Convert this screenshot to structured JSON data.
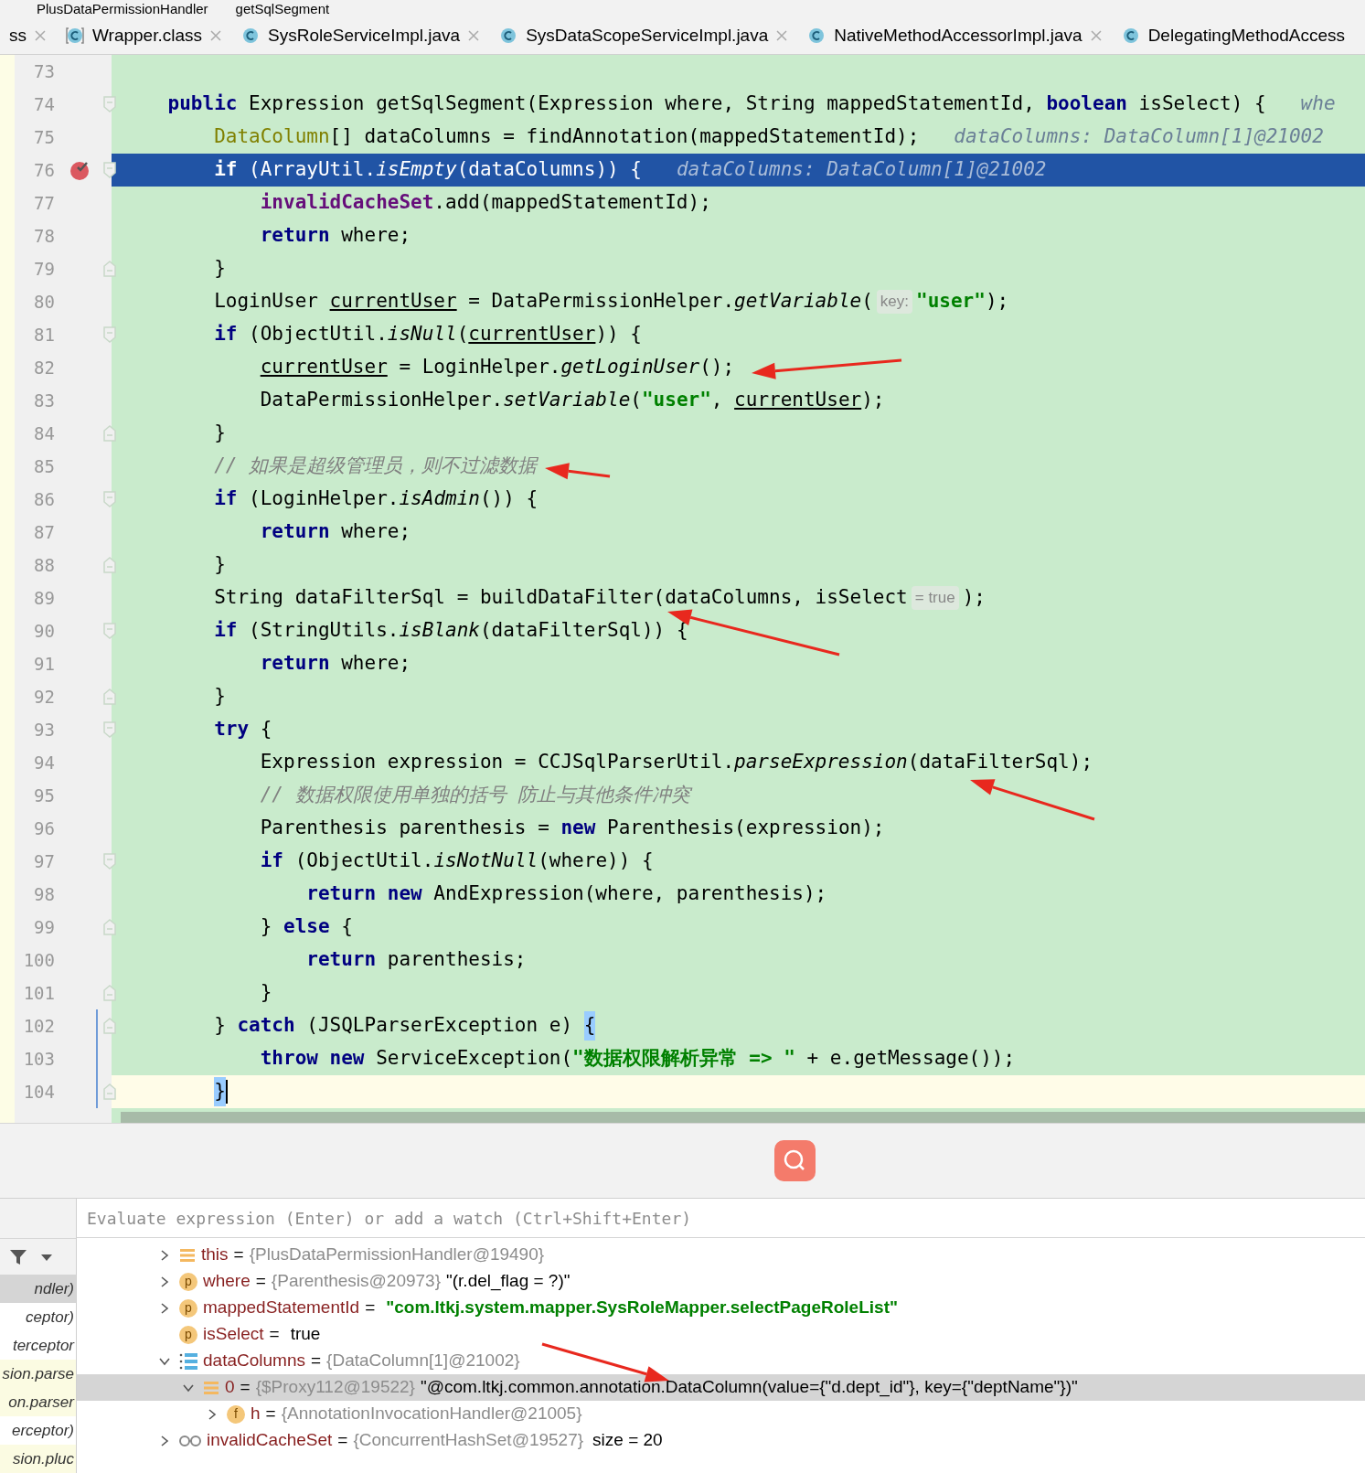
{
  "breadcrumb": [
    "PlusDataPermissionHandler",
    "getSqlSegment"
  ],
  "tabs": [
    {
      "label": "ss",
      "kind": "none",
      "closable": true
    },
    {
      "label": "Wrapper.class",
      "kind": "class",
      "closable": true
    },
    {
      "label": "SysRoleServiceImpl.java",
      "kind": "java",
      "closable": true
    },
    {
      "label": "SysDataScopeServiceImpl.java",
      "kind": "java",
      "closable": true
    },
    {
      "label": "NativeMethodAccessorImpl.java",
      "kind": "java",
      "closable": true
    },
    {
      "label": "DelegatingMethodAccess",
      "kind": "java",
      "closable": false
    }
  ],
  "lines": [
    {
      "number": "73"
    },
    {
      "number": "74",
      "kind": "block_start",
      "tokens": [
        {
          "kind": "keyword",
          "text": "public"
        },
        {
          "kind": "plain",
          "text": " Expression getSqlSegment(Expression where, String mappedStatementId, "
        },
        {
          "kind": "keyword",
          "text": "boolean"
        },
        {
          "kind": "plain",
          "text": " isSelect) {"
        },
        {
          "kind": "debug",
          "text": "   whe"
        }
      ],
      "children": [
        {
          "number": "75",
          "tokens": [
            {
              "kind": "type",
              "text": "DataColumn"
            },
            {
              "kind": "plain",
              "text": "[] dataColumns = findAnnotation(mappedStatementId);"
            },
            {
              "kind": "debug",
              "text": "   dataColumns: DataColumn[1]@21002"
            }
          ]
        },
        {
          "number": "76",
          "kind": "block_start",
          "breakpoint": true,
          "selected": true,
          "tokens": [
            {
              "kind": "keyword",
              "text": "if"
            },
            {
              "kind": "plain",
              "text": " (ArrayUtil."
            },
            {
              "kind": "static",
              "text": "isEmpty"
            },
            {
              "kind": "plain",
              "text": "(dataColumns)) {"
            },
            {
              "kind": "debug",
              "text": "   dataColumns: DataColumn[1]@21002"
            }
          ],
          "children": [
            {
              "number": "77",
              "tokens": [
                {
                  "kind": "field",
                  "text": "invalidCacheSet"
                },
                {
                  "kind": "plain",
                  "text": ".add(mappedStatementId);"
                }
              ]
            },
            {
              "number": "78",
              "tokens": [
                {
                  "kind": "keyword",
                  "text": "return"
                },
                {
                  "kind": "plain",
                  "text": " where;"
                }
              ]
            }
          ]
        },
        {
          "number": "79",
          "kind": "block_end",
          "tokens": [
            {
              "kind": "plain",
              "text": "}"
            }
          ]
        },
        {
          "number": "80",
          "tokens": [
            {
              "kind": "plain",
              "text": "LoginUser "
            },
            {
              "kind": "reassigned",
              "text": "currentUser"
            },
            {
              "kind": "plain",
              "text": " = DataPermissionHelper."
            },
            {
              "kind": "static",
              "text": "getVariable"
            },
            {
              "kind": "plain",
              "text": "("
            },
            {
              "kind": "hint",
              "text": "key:"
            },
            {
              "kind": "string",
              "text": "\"user\""
            },
            {
              "kind": "plain",
              "text": ");"
            }
          ]
        },
        {
          "number": "81",
          "kind": "block_start",
          "tokens": [
            {
              "kind": "keyword",
              "text": "if"
            },
            {
              "kind": "plain",
              "text": " (ObjectUtil."
            },
            {
              "kind": "static",
              "text": "isNull"
            },
            {
              "kind": "plain",
              "text": "("
            },
            {
              "kind": "reassigned",
              "text": "currentUser"
            },
            {
              "kind": "plain",
              "text": ")) {"
            }
          ],
          "children": [
            {
              "number": "82",
              "tokens": [
                {
                  "kind": "reassigned",
                  "text": "currentUser"
                },
                {
                  "kind": "plain",
                  "text": " = LoginHelper."
                },
                {
                  "kind": "static",
                  "text": "getLoginUser"
                },
                {
                  "kind": "plain",
                  "text": "();"
                }
              ]
            },
            {
              "number": "83",
              "tokens": [
                {
                  "kind": "plain",
                  "text": "DataPermissionHelper."
                },
                {
                  "kind": "static",
                  "text": "setVariable"
                },
                {
                  "kind": "plain",
                  "text": "("
                },
                {
                  "kind": "string",
                  "text": "\"user\""
                },
                {
                  "kind": "plain",
                  "text": ", "
                },
                {
                  "kind": "reassigned",
                  "text": "currentUser"
                },
                {
                  "kind": "plain",
                  "text": ");"
                }
              ]
            }
          ]
        },
        {
          "number": "84",
          "kind": "block_end",
          "tokens": [
            {
              "kind": "plain",
              "text": "}"
            }
          ]
        },
        {
          "number": "85",
          "tokens": [
            {
              "kind": "comment",
              "text": "// 如果是超级管理员，则不过滤数据"
            }
          ]
        },
        {
          "number": "86",
          "kind": "block_start",
          "tokens": [
            {
              "kind": "keyword",
              "text": "if"
            },
            {
              "kind": "plain",
              "text": " (LoginHelper."
            },
            {
              "kind": "static",
              "text": "isAdmin"
            },
            {
              "kind": "plain",
              "text": "()) {"
            }
          ],
          "children": [
            {
              "number": "87",
              "tokens": [
                {
                  "kind": "keyword",
                  "text": "return"
                },
                {
                  "kind": "plain",
                  "text": " where;"
                }
              ]
            }
          ]
        },
        {
          "number": "88",
          "kind": "block_end",
          "tokens": [
            {
              "kind": "plain",
              "text": "}"
            }
          ]
        },
        {
          "number": "89",
          "tokens": [
            {
              "kind": "plain",
              "text": "String dataFilterSql = buildDataFilter(dataColumns, isSelect"
            },
            {
              "kind": "hint",
              "text": "= true"
            },
            {
              "kind": "plain",
              "text": ");"
            }
          ]
        },
        {
          "number": "90",
          "kind": "block_start",
          "tokens": [
            {
              "kind": "keyword",
              "text": "if"
            },
            {
              "kind": "plain",
              "text": " (StringUtils."
            },
            {
              "kind": "static",
              "text": "isBlank"
            },
            {
              "kind": "plain",
              "text": "(dataFilterSql)) {"
            }
          ],
          "children": [
            {
              "number": "91",
              "tokens": [
                {
                  "kind": "keyword",
                  "text": "return"
                },
                {
                  "kind": "plain",
                  "text": " where;"
                }
              ]
            }
          ]
        },
        {
          "number": "92",
          "kind": "block_end",
          "tokens": [
            {
              "kind": "plain",
              "text": "}"
            }
          ]
        },
        {
          "number": "93",
          "kind": "block_start",
          "tokens": [
            {
              "kind": "keyword",
              "text": "try"
            },
            {
              "kind": "plain",
              "text": " {"
            }
          ],
          "children": [
            {
              "number": "94",
              "tokens": [
                {
                  "kind": "plain",
                  "text": "Expression expression = CCJSqlParserUtil."
                },
                {
                  "kind": "static",
                  "text": "parseExpression"
                },
                {
                  "kind": "plain",
                  "text": "(dataFilterSql);"
                }
              ]
            },
            {
              "number": "95",
              "tokens": [
                {
                  "kind": "comment",
                  "text": "// 数据权限使用单独的括号 防止与其他条件冲突"
                }
              ]
            },
            {
              "number": "96",
              "tokens": [
                {
                  "kind": "plain",
                  "text": "Parenthesis parenthesis = "
                },
                {
                  "kind": "keyword",
                  "text": "new"
                },
                {
                  "kind": "plain",
                  "text": " Parenthesis(expression);"
                }
              ]
            },
            {
              "number": "97",
              "kind": "block_start",
              "tokens": [
                {
                  "kind": "keyword",
                  "text": "if"
                },
                {
                  "kind": "plain",
                  "text": " (ObjectUtil."
                },
                {
                  "kind": "static",
                  "text": "isNotNull"
                },
                {
                  "kind": "plain",
                  "text": "(where)) {"
                }
              ],
              "children": [
                {
                  "number": "98",
                  "tokens": [
                    {
                      "kind": "keyword",
                      "text": "return new"
                    },
                    {
                      "kind": "plain",
                      "text": " AndExpression(where, parenthesis);"
                    }
                  ]
                }
              ]
            },
            {
              "number": "99",
              "kind": "block_end",
              "tokens": [
                {
                  "kind": "plain",
                  "text": "} "
                },
                {
                  "kind": "keyword",
                  "text": "else"
                },
                {
                  "kind": "plain",
                  "text": " {"
                }
              ],
              "children": [
                {
                  "number": "100",
                  "tokens": [
                    {
                      "kind": "keyword",
                      "text": "return"
                    },
                    {
                      "kind": "plain",
                      "text": " parenthesis;"
                    }
                  ]
                }
              ]
            },
            {
              "number": "101",
              "kind": "block_end",
              "tokens": [
                {
                  "kind": "plain",
                  "text": "}"
                }
              ]
            }
          ]
        },
        {
          "number": "102",
          "kind": "block_end",
          "changed": true,
          "tokens": [
            {
              "kind": "plain",
              "text": "} "
            },
            {
              "kind": "keyword",
              "text": "catch"
            },
            {
              "kind": "plain",
              "text": " (JSQLParserException e) "
            },
            {
              "kind": "brace",
              "text": "{"
            }
          ],
          "children": [
            {
              "number": "103",
              "changed": true,
              "tokens": [
                {
                  "kind": "keyword",
                  "text": "throw new"
                },
                {
                  "kind": "plain",
                  "text": " ServiceException("
                },
                {
                  "kind": "string",
                  "text": "\"数据权限解析异常 => \""
                },
                {
                  "kind": "plain",
                  "text": " + e.getMessage());"
                }
              ]
            }
          ]
        },
        {
          "number": "104",
          "kind": "block_end",
          "changed": true,
          "current": true,
          "tokens": [
            {
              "kind": "brace",
              "text": "}"
            }
          ]
        }
      ]
    }
  ],
  "evaluate": {
    "placeholder": "Evaluate expression (Enter) or add a watch (Ctrl+Shift+Enter)"
  },
  "frames": [
    {
      "label": "ndler)",
      "selected": true,
      "library": false
    },
    {
      "label": "ceptor)",
      "selected": false,
      "library": false
    },
    {
      "label": "terceptor",
      "selected": false,
      "library": false
    },
    {
      "label": "sion.parse",
      "selected": false,
      "library": true
    },
    {
      "label": "on.parser",
      "selected": false,
      "library": true
    },
    {
      "label": "erceptor)",
      "selected": false,
      "library": false
    },
    {
      "label": "sion.pluc",
      "selected": false,
      "library": true
    }
  ],
  "variables": [
    {
      "name": "this",
      "op": "=",
      "type": "{PlusDataPermissionHandler@19490}",
      "kind": "object",
      "expanded": false,
      "selected": false
    },
    {
      "name": "where",
      "op": "=",
      "type": "{Parenthesis@20973}",
      "value": "\"(r.del_flag = ?)\"",
      "kind": "param",
      "badge": "p",
      "expanded": false,
      "selected": false
    },
    {
      "name": "mappedStatementId",
      "op": "=",
      "value": "\"com.ltkj.system.mapper.SysRoleMapper.selectPageRoleList\"",
      "string": true,
      "kind": "param",
      "badge": "p",
      "expanded": false,
      "selected": false
    },
    {
      "name": "isSelect",
      "op": "=",
      "value": "true",
      "kind": "param",
      "badge": "p",
      "selected": false
    },
    {
      "name": "dataColumns",
      "op": "=",
      "type": "{DataColumn[1]@21002}",
      "kind": "array",
      "expanded": true,
      "selected": false,
      "children": [
        {
          "name": "0",
          "op": "=",
          "type": "{$Proxy112@19522}",
          "value": "\"@com.ltkj.common.annotation.DataColumn(value={\"d.dept_id\"}, key={\"deptName\"})\"",
          "kind": "object",
          "expanded": true,
          "selected": true,
          "children": [
            {
              "name": "h",
              "op": "=",
              "type": "{AnnotationInvocationHandler@21005}",
              "kind": "field",
              "badge": "f",
              "expanded": false,
              "selected": false
            }
          ]
        }
      ]
    },
    {
      "name": "invalidCacheSet",
      "op": "=",
      "type": "{ConcurrentHashSet@19527}",
      "extra": "size = 20",
      "kind": "watch",
      "expanded": false,
      "selected": false
    }
  ]
}
